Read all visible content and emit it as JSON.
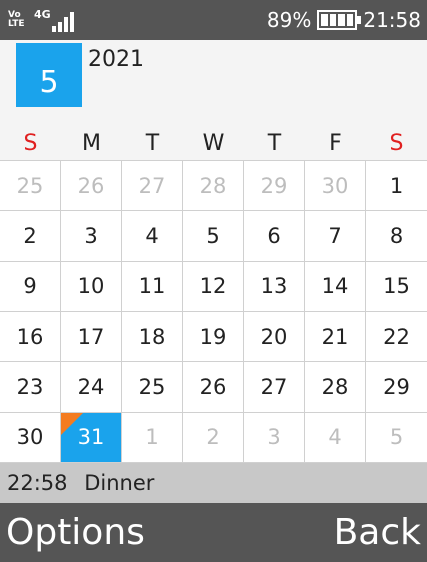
{
  "status_bar": {
    "volte_top": "Vo",
    "volte_bottom": "LTE",
    "network": "4G",
    "signal_level": 4,
    "battery_percent": "89%",
    "time": "21:58"
  },
  "header": {
    "month": "5",
    "year": "2021"
  },
  "weekdays": [
    {
      "label": "S",
      "weekend": true
    },
    {
      "label": "M",
      "weekend": false
    },
    {
      "label": "T",
      "weekend": false
    },
    {
      "label": "W",
      "weekend": false
    },
    {
      "label": "T",
      "weekend": false
    },
    {
      "label": "F",
      "weekend": false
    },
    {
      "label": "S",
      "weekend": true
    }
  ],
  "days": [
    {
      "label": "25",
      "state": "dim"
    },
    {
      "label": "26",
      "state": "dim"
    },
    {
      "label": "27",
      "state": "dim"
    },
    {
      "label": "28",
      "state": "dim"
    },
    {
      "label": "29",
      "state": "dim"
    },
    {
      "label": "30",
      "state": "dim"
    },
    {
      "label": "1",
      "state": "normal"
    },
    {
      "label": "2",
      "state": "normal"
    },
    {
      "label": "3",
      "state": "normal"
    },
    {
      "label": "4",
      "state": "normal"
    },
    {
      "label": "5",
      "state": "normal"
    },
    {
      "label": "6",
      "state": "normal"
    },
    {
      "label": "7",
      "state": "normal"
    },
    {
      "label": "8",
      "state": "normal"
    },
    {
      "label": "9",
      "state": "normal"
    },
    {
      "label": "10",
      "state": "normal"
    },
    {
      "label": "11",
      "state": "normal"
    },
    {
      "label": "12",
      "state": "normal"
    },
    {
      "label": "13",
      "state": "normal"
    },
    {
      "label": "14",
      "state": "normal"
    },
    {
      "label": "15",
      "state": "normal"
    },
    {
      "label": "16",
      "state": "normal"
    },
    {
      "label": "17",
      "state": "normal"
    },
    {
      "label": "18",
      "state": "normal"
    },
    {
      "label": "19",
      "state": "normal"
    },
    {
      "label": "20",
      "state": "normal"
    },
    {
      "label": "21",
      "state": "normal"
    },
    {
      "label": "22",
      "state": "normal"
    },
    {
      "label": "23",
      "state": "normal"
    },
    {
      "label": "24",
      "state": "normal"
    },
    {
      "label": "25",
      "state": "normal"
    },
    {
      "label": "26",
      "state": "normal"
    },
    {
      "label": "27",
      "state": "normal"
    },
    {
      "label": "28",
      "state": "normal"
    },
    {
      "label": "29",
      "state": "normal"
    },
    {
      "label": "30",
      "state": "normal"
    },
    {
      "label": "31",
      "state": "selected"
    },
    {
      "label": "1",
      "state": "dim"
    },
    {
      "label": "2",
      "state": "dim"
    },
    {
      "label": "3",
      "state": "dim"
    },
    {
      "label": "4",
      "state": "dim"
    },
    {
      "label": "5",
      "state": "dim"
    }
  ],
  "event": {
    "time": "22:58",
    "title": "Dinner"
  },
  "softkeys": {
    "left": "Options",
    "right": "Back"
  },
  "colors": {
    "accent": "#1aa3ec",
    "event_marker": "#f47c20",
    "weekend": "#e02020"
  }
}
